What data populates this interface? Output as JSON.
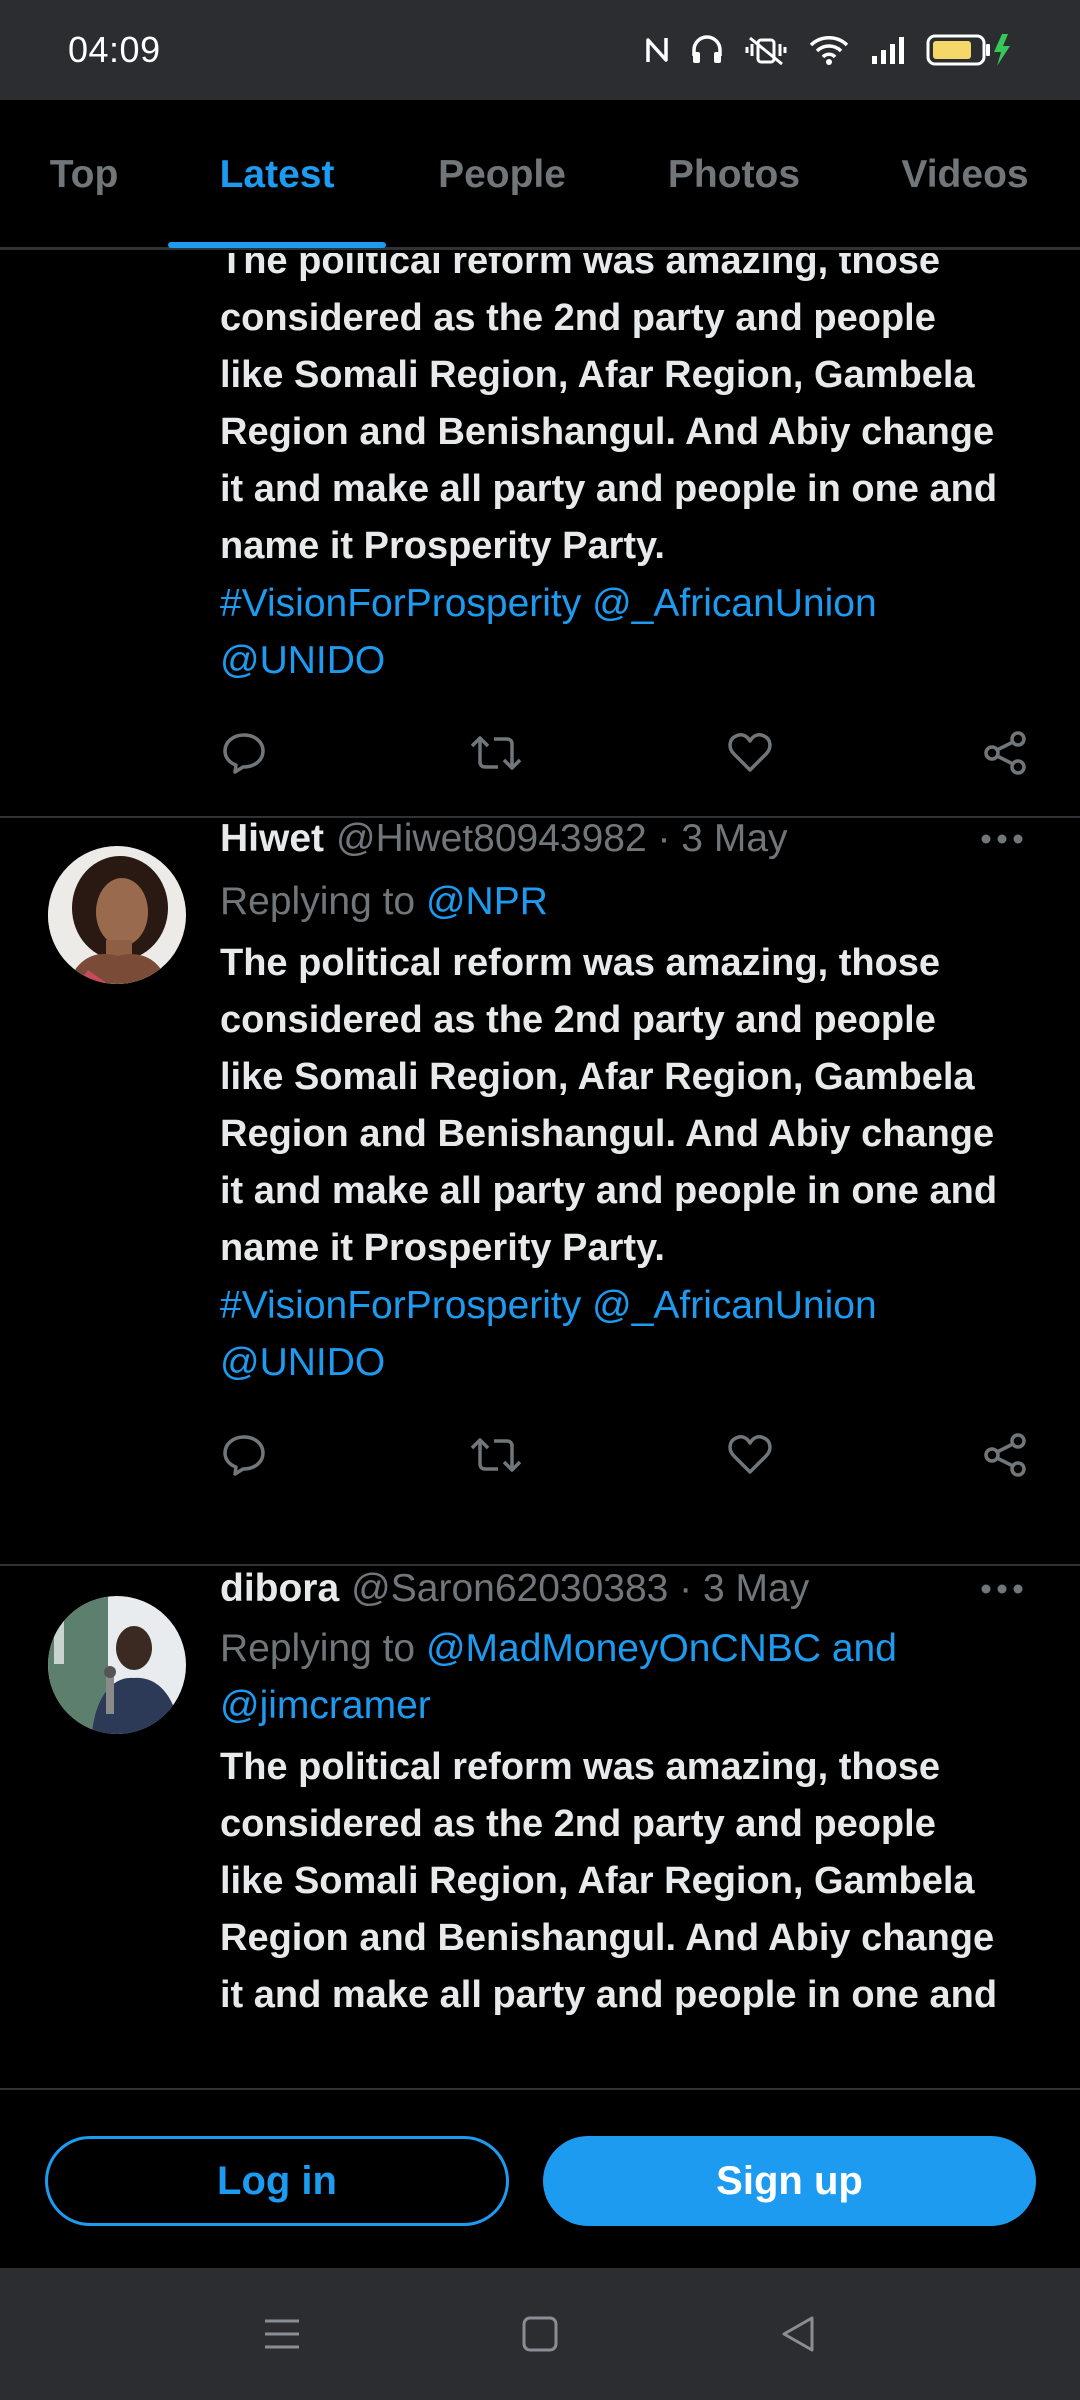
{
  "status_bar": {
    "time": "04:09",
    "icons": [
      "nfc-icon",
      "headphones-icon",
      "vibrate-off-icon",
      "wifi-icon",
      "signal-icon",
      "battery-charging-icon"
    ]
  },
  "tabs": [
    {
      "label": "Top",
      "active": false
    },
    {
      "label": "Latest",
      "active": true
    },
    {
      "label": "People",
      "active": false
    },
    {
      "label": "Photos",
      "active": false
    },
    {
      "label": "Videos",
      "active": false
    }
  ],
  "tweets": [
    {
      "body_lines": [
        "The political reform was amazing, those",
        "considered as the 2nd party and people",
        "like Somali Region, Afar Region, Gambela",
        "Region and Benishangul. And Abiy change",
        "it and make all party and people in one and",
        "name it Prosperity Party."
      ],
      "links_lines": [
        "#VisionForProsperity @_AfricanUnion",
        "@UNIDO"
      ]
    },
    {
      "name": "Hiwet",
      "handle": "@Hiwet80943982 · 3 May",
      "replying_prefix": "Replying to ",
      "replying_to": "@NPR",
      "body_lines": [
        "The political reform was amazing, those",
        "considered as the 2nd party and people",
        "like Somali Region, Afar Region, Gambela",
        "Region and Benishangul. And Abiy change",
        "it and make all party and people in one and",
        "name it Prosperity Party."
      ],
      "links_lines": [
        "#VisionForProsperity @_AfricanUnion",
        "@UNIDO"
      ]
    },
    {
      "name": "dibora",
      "handle": "@Saron62030383 · 3 May",
      "replying_prefix": "Replying to ",
      "replying_to_line1": "@MadMoneyOnCNBC and",
      "replying_to_line2": "@jimcramer",
      "body_lines": [
        "The political reform was amazing, those",
        "considered as the 2nd party and people",
        "like Somali Region, Afar Region, Gambela",
        "Region and Benishangul. And Abiy change",
        "it and make all party and people in one and"
      ]
    }
  ],
  "buttons": {
    "login": "Log in",
    "signup": "Sign up"
  },
  "colors": {
    "accent": "#1d9bf0",
    "background": "#000000",
    "muted": "#71767b",
    "text": "#e7e9ea",
    "divider": "#2f3336",
    "system_bar": "#2b2d31"
  }
}
